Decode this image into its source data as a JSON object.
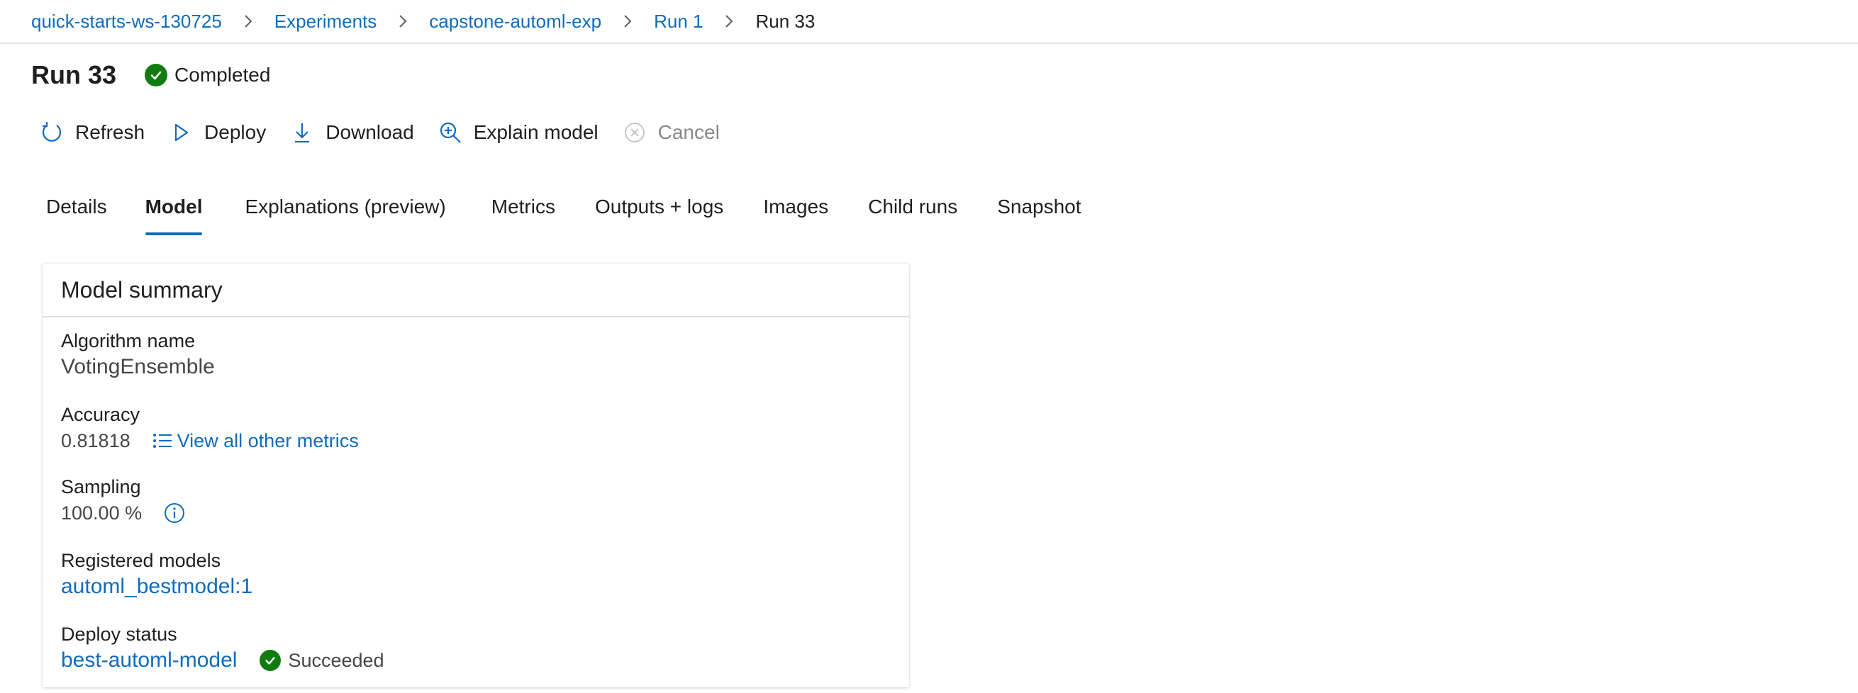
{
  "breadcrumb": {
    "items": [
      "quick-starts-ws-130725",
      "Experiments",
      "capstone-automl-exp",
      "Run 1"
    ],
    "current": "Run 33"
  },
  "header": {
    "title": "Run 33",
    "status": "Completed",
    "status_color": "#107c10"
  },
  "toolbar": {
    "refresh": "Refresh",
    "deploy": "Deploy",
    "download": "Download",
    "explain": "Explain model",
    "cancel": "Cancel"
  },
  "tabs": [
    {
      "label": "Details",
      "active": false
    },
    {
      "label": "Model",
      "active": true
    },
    {
      "label": "Explanations (preview)",
      "active": false
    },
    {
      "label": "Metrics",
      "active": false
    },
    {
      "label": "Outputs + logs",
      "active": false
    },
    {
      "label": "Images",
      "active": false
    },
    {
      "label": "Child runs",
      "active": false
    },
    {
      "label": "Snapshot",
      "active": false
    }
  ],
  "model_summary": {
    "title": "Model summary",
    "algorithm_label": "Algorithm name",
    "algorithm_value": "VotingEnsemble",
    "accuracy_label": "Accuracy",
    "accuracy_value": "0.81818",
    "metrics_link": "View all other metrics",
    "sampling_label": "Sampling",
    "sampling_value": "100.00 %",
    "registered_label": "Registered models",
    "registered_value": "automl_bestmodel:1",
    "deploy_label": "Deploy status",
    "deploy_value": "best-automl-model",
    "deploy_status": "Succeeded"
  },
  "colors": {
    "accent": "#0f6cbd",
    "success": "#107c10",
    "disabled": "#8a8886"
  }
}
